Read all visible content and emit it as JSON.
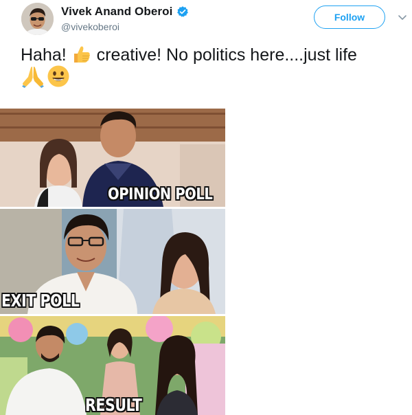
{
  "user": {
    "display_name": "Vivek Anand Oberoi",
    "handle": "@vivekoberoi",
    "verified": true
  },
  "follow_label": "Follow",
  "tweet": {
    "text_part1": "Haha! ",
    "text_part2": " creative! No politics here....just life",
    "emojis": [
      "thumbs-up",
      "folded-hands",
      "smiley"
    ]
  },
  "meme": {
    "panels": [
      {
        "caption": "OPINION POLL"
      },
      {
        "caption": "EXIT POLL"
      },
      {
        "caption": "RESULT"
      }
    ]
  },
  "colors": {
    "accent": "#1da1f2",
    "text": "#14171a",
    "muted": "#657786"
  }
}
